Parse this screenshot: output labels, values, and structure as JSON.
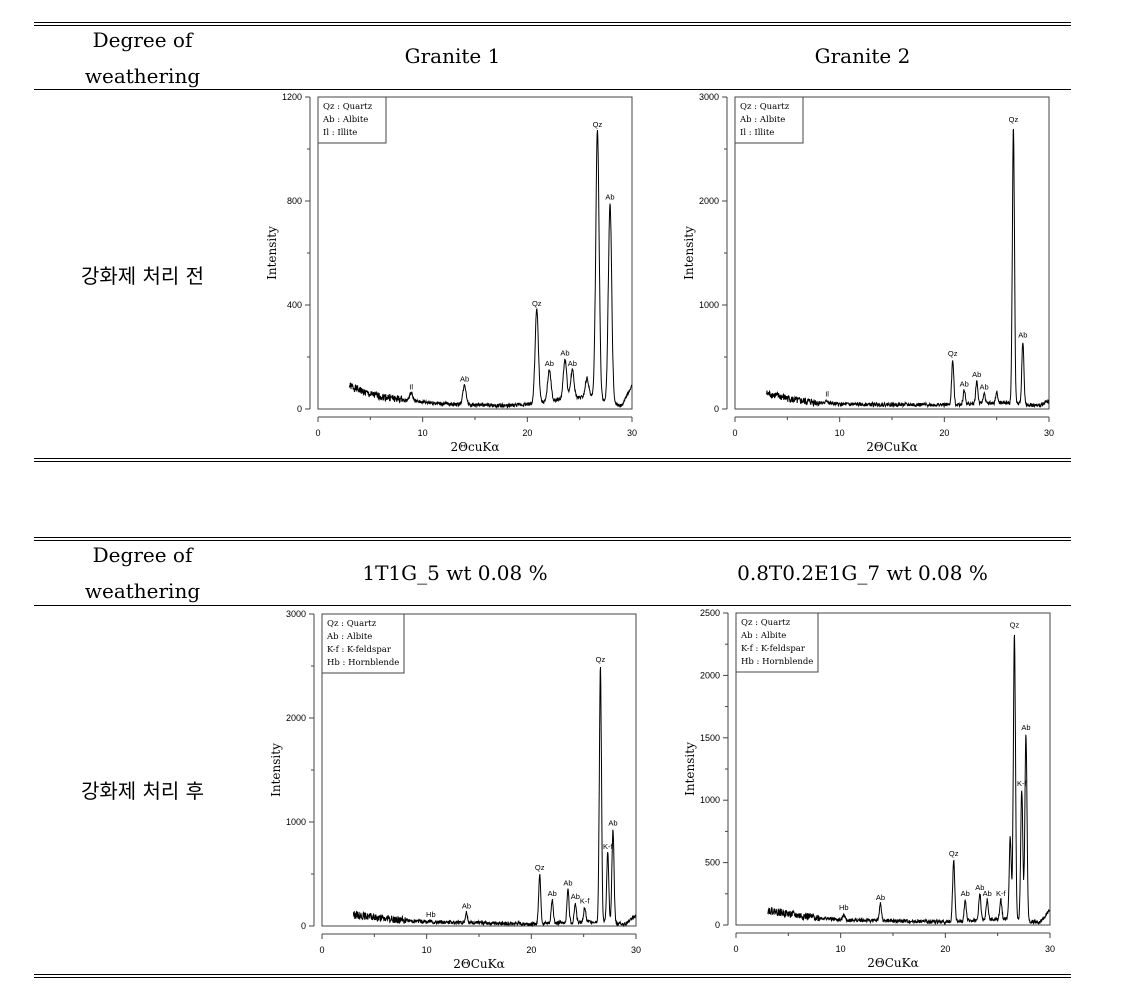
{
  "tables": [
    {
      "header": {
        "row_label": "Degree of weathering",
        "col1": "Granite 1",
        "col2": "Granite 2"
      },
      "row_label": "강화제 처리 전"
    },
    {
      "header": {
        "row_label": "Degree of weathering",
        "col1": "1T1G_5 wt 0.08 %",
        "col2": "0.8T0.2E1G_7 wt 0.08 %"
      },
      "row_label": "강화제 처리 후"
    }
  ],
  "chart_data": [
    {
      "type": "line",
      "title": "",
      "xlabel": "2ΘcuKα",
      "ylabel": "Intensity",
      "xlim": [
        0,
        30
      ],
      "ylim": [
        0,
        1200
      ],
      "xticks": [
        0,
        10,
        20,
        30
      ],
      "yticks": [
        0,
        400,
        800,
        1200
      ],
      "legend": [
        "Qz : Quartz",
        "Ab : Albite",
        "Il : Illite"
      ],
      "legend_position": "top-left",
      "baseline": [
        [
          3,
          90
        ],
        [
          5,
          55
        ],
        [
          9,
          30
        ],
        [
          12,
          20
        ],
        [
          18,
          12
        ],
        [
          20.5,
          20
        ],
        [
          22.8,
          35
        ],
        [
          25,
          45
        ],
        [
          26,
          50
        ],
        [
          29,
          10
        ],
        [
          30,
          90
        ]
      ],
      "peaks": [
        {
          "x": 8.9,
          "y": 60,
          "label": "Il"
        },
        {
          "x": 14.0,
          "y": 90,
          "label": "Ab"
        },
        {
          "x": 20.9,
          "y": 380,
          "label": "Qz"
        },
        {
          "x": 22.1,
          "y": 150,
          "label": "Ab"
        },
        {
          "x": 23.6,
          "y": 190,
          "label": "Ab"
        },
        {
          "x": 24.3,
          "y": 150,
          "label": "Ab"
        },
        {
          "x": 25.7,
          "y": 120,
          "label": ""
        },
        {
          "x": 26.7,
          "y": 1070,
          "label": "Qz"
        },
        {
          "x": 27.9,
          "y": 790,
          "label": "Ab"
        }
      ]
    },
    {
      "type": "line",
      "title": "",
      "xlabel": "2ΘCuKα",
      "ylabel": "Intensity",
      "xlim": [
        0,
        30
      ],
      "ylim": [
        0,
        3000
      ],
      "xticks": [
        0,
        10,
        20,
        30
      ],
      "yticks": [
        0,
        1000,
        2000,
        3000
      ],
      "legend": [
        "Qz : Quartz",
        "Ab : Albite",
        "Il : Illite"
      ],
      "legend_position": "top-left",
      "baseline": [
        [
          3,
          150
        ],
        [
          6,
          80
        ],
        [
          10,
          45
        ],
        [
          20,
          40
        ],
        [
          26,
          60
        ],
        [
          29,
          30
        ],
        [
          30,
          80
        ]
      ],
      "peaks": [
        {
          "x": 8.8,
          "y": 80,
          "label": "Il"
        },
        {
          "x": 20.8,
          "y": 470,
          "label": "Qz"
        },
        {
          "x": 21.9,
          "y": 180,
          "label": "Ab"
        },
        {
          "x": 23.1,
          "y": 270,
          "label": "Ab"
        },
        {
          "x": 23.8,
          "y": 150,
          "label": "Ab"
        },
        {
          "x": 25.0,
          "y": 160,
          "label": ""
        },
        {
          "x": 26.6,
          "y": 2720,
          "label": "Qz"
        },
        {
          "x": 27.5,
          "y": 650,
          "label": "Ab"
        }
      ]
    },
    {
      "type": "line",
      "title": "",
      "xlabel": "2ΘCuKα",
      "ylabel": "Intensity",
      "xlim": [
        0,
        30
      ],
      "ylim": [
        0,
        3000
      ],
      "xticks": [
        0,
        10,
        20,
        30
      ],
      "yticks": [
        0,
        1000,
        2000,
        3000
      ],
      "legend": [
        "Qz : Quartz",
        "Ab : Albite",
        "K-f : K-feldspar",
        "Hb : Hornblende"
      ],
      "legend_position": "top-left",
      "baseline": [
        [
          3,
          110
        ],
        [
          6,
          70
        ],
        [
          10,
          40
        ],
        [
          20,
          20
        ],
        [
          26,
          40
        ],
        [
          29,
          20
        ],
        [
          30,
          100
        ]
      ],
      "peaks": [
        {
          "x": 10.4,
          "y": 50,
          "label": "Hb"
        },
        {
          "x": 13.8,
          "y": 130,
          "label": "Ab"
        },
        {
          "x": 20.8,
          "y": 500,
          "label": "Qz"
        },
        {
          "x": 22.0,
          "y": 250,
          "label": "Ab"
        },
        {
          "x": 23.5,
          "y": 350,
          "label": "Ab"
        },
        {
          "x": 24.2,
          "y": 220,
          "label": "Ab"
        },
        {
          "x": 25.1,
          "y": 180,
          "label": "K-f"
        },
        {
          "x": 26.6,
          "y": 2500,
          "label": "Qz"
        },
        {
          "x": 27.3,
          "y": 700,
          "label": "K-f"
        },
        {
          "x": 27.8,
          "y": 930,
          "label": "Ab"
        }
      ]
    },
    {
      "type": "line",
      "title": "",
      "xlabel": "2ΘCuKα",
      "ylabel": "Intensity",
      "xlim": [
        0,
        30
      ],
      "ylim": [
        0,
        2500
      ],
      "xticks": [
        0,
        10,
        20,
        30
      ],
      "yticks": [
        0,
        500,
        1000,
        1500,
        2000,
        2500
      ],
      "legend": [
        "Qz : Quartz",
        "Ab : Albite",
        "K-f : K-feldspar",
        "Hb : Hornblende"
      ],
      "legend_position": "top-left",
      "baseline": [
        [
          3,
          120
        ],
        [
          6,
          75
        ],
        [
          10,
          40
        ],
        [
          20,
          25
        ],
        [
          26,
          50
        ],
        [
          29,
          20
        ],
        [
          30,
          120
        ]
      ],
      "peaks": [
        {
          "x": 10.3,
          "y": 90,
          "label": "Hb"
        },
        {
          "x": 13.8,
          "y": 170,
          "label": "Ab"
        },
        {
          "x": 20.8,
          "y": 520,
          "label": "Qz"
        },
        {
          "x": 21.9,
          "y": 200,
          "label": "Ab"
        },
        {
          "x": 23.3,
          "y": 250,
          "label": "Ab"
        },
        {
          "x": 24.0,
          "y": 200,
          "label": "Ab"
        },
        {
          "x": 25.3,
          "y": 200,
          "label": "K-f"
        },
        {
          "x": 26.2,
          "y": 700,
          "label": ""
        },
        {
          "x": 26.6,
          "y": 2350,
          "label": "Qz"
        },
        {
          "x": 27.3,
          "y": 1080,
          "label": "K-f"
        },
        {
          "x": 27.7,
          "y": 1530,
          "label": "Ab"
        }
      ]
    }
  ]
}
